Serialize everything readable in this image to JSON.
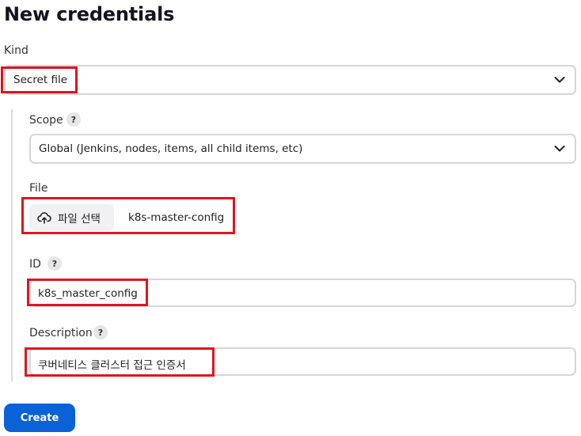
{
  "page": {
    "title": "New credentials"
  },
  "kind": {
    "label": "Kind",
    "value": "Secret file"
  },
  "scope": {
    "label": "Scope",
    "help": "?",
    "value": "Global (Jenkins, nodes, items, all child items, etc)"
  },
  "file": {
    "label": "File",
    "button_label": "파일 선택",
    "filename": "k8s-master-config"
  },
  "id": {
    "label": "ID",
    "help": "?",
    "value": "k8s_master_config"
  },
  "description": {
    "label": "Description",
    "help": "?",
    "value": "쿠버네티스 클러스터 접근 인증서"
  },
  "actions": {
    "create_label": "Create"
  },
  "icons": {
    "chevron": "chevron-down-icon",
    "upload": "cloud-upload-icon"
  },
  "colors": {
    "primary": "#0b62d6",
    "highlight": "#e0141e",
    "border": "#d6d6d9"
  }
}
